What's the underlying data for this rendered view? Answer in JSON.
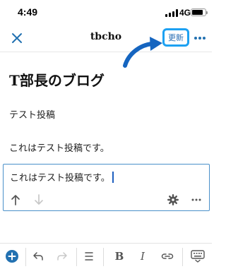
{
  "status_bar": {
    "time": "4:49",
    "network": "4G"
  },
  "header": {
    "title": "tbcho",
    "update_label": "更新"
  },
  "post": {
    "title": "T部長のブログ",
    "blocks": [
      "テスト投稿",
      "これはテスト投稿です。"
    ],
    "active_block": "これはテスト投稿です。"
  },
  "toolbar": {
    "bold": "B",
    "italic": "I"
  },
  "colors": {
    "accent": "#1da1f2",
    "link": "#2a6fb5",
    "primary": "#2271b1",
    "annotation_arrow": "#1565c0"
  },
  "icons": {
    "header": [
      "close-icon",
      "more-icon"
    ],
    "block": [
      "arrow-up-icon",
      "arrow-down-icon",
      "gear-icon",
      "more-icon"
    ],
    "toolbar": [
      "plus-circle-icon",
      "undo-icon",
      "redo-icon",
      "list-icon",
      "bold-icon",
      "italic-icon",
      "link-icon",
      "keyboard-hide-icon"
    ]
  }
}
